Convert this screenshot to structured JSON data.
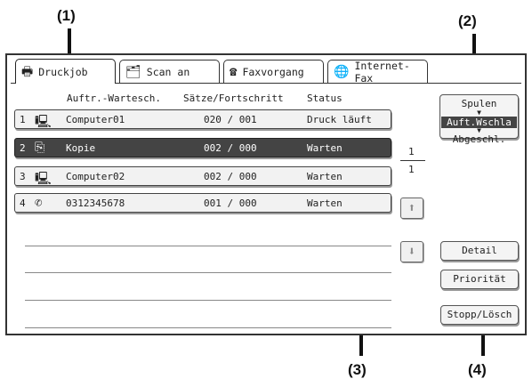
{
  "callouts": {
    "c1": "(1)",
    "c2": "(2)",
    "c3": "(3)",
    "c4": "(4)"
  },
  "tabs": [
    {
      "label": "Druckjob",
      "icon": "printer-icon",
      "glyph": "🖶"
    },
    {
      "label": "Scan an",
      "icon": "scan-icon",
      "glyph": "🗂"
    },
    {
      "label": "Faxvorgang",
      "icon": "fax-icon",
      "glyph": "☎"
    },
    {
      "label": "Internet-Fax",
      "icon": "internet-fax-icon",
      "glyph": "🌐"
    }
  ],
  "headers": {
    "queue": "Auftr.-Wartesch.",
    "sets": "Sätze/Fortschritt",
    "status": "Status"
  },
  "jobs": [
    {
      "num": "1",
      "icon": "computer-icon",
      "glyph": "🖳",
      "name": "Computer01",
      "progress": "020 / 001",
      "status": "Druck läuft"
    },
    {
      "num": "2",
      "icon": "copy-icon",
      "glyph": "⎘",
      "name": "Kopie",
      "progress": "002 / 000",
      "status": "Warten"
    },
    {
      "num": "3",
      "icon": "computer-icon",
      "glyph": "🖳",
      "name": "Computer02",
      "progress": "002 / 000",
      "status": "Warten"
    },
    {
      "num": "4",
      "icon": "phone-icon",
      "glyph": "✆",
      "name": "0312345678",
      "progress": "001 / 000",
      "status": "Warten"
    }
  ],
  "page": {
    "current": "1",
    "total": "1"
  },
  "mode_switch": {
    "top": "Spulen",
    "middle": "Auft.Wschla",
    "bottom": "Abgeschl."
  },
  "buttons": {
    "detail": "Detail",
    "priority": "Priorität",
    "stop": "Stopp/Lösch"
  },
  "colors": {
    "selected_row": "#444444",
    "panel_border": "#333333"
  }
}
